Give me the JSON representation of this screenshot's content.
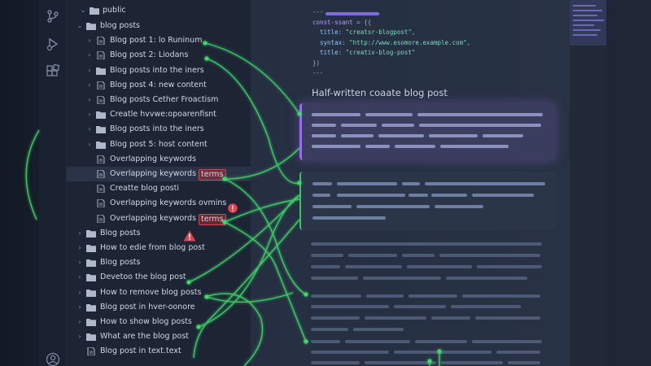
{
  "explorer": {
    "root": {
      "label": "public"
    },
    "items": [
      {
        "label": "blog posts",
        "depth": 1,
        "type": "folder",
        "chevron": "open"
      },
      {
        "label": "Blog post 1: lo Runinum",
        "depth": 2,
        "type": "file",
        "chevron": "closed"
      },
      {
        "label": "Blog post 2: Liodans",
        "depth": 2,
        "type": "file",
        "chevron": "closed"
      },
      {
        "label": "Blog posts into the iners",
        "depth": 2,
        "type": "folder",
        "chevron": "closed"
      },
      {
        "label": "Blog post 4: new content",
        "depth": 2,
        "type": "file",
        "chevron": "closed"
      },
      {
        "label": "Blog posts Cether Froactism",
        "depth": 2,
        "type": "file",
        "chevron": "closed"
      },
      {
        "label": "Creatle hvvwe:opoarenfisnt",
        "depth": 2,
        "type": "folder",
        "chevron": "closed"
      },
      {
        "label": "Blog posts into the iners",
        "depth": 2,
        "type": "folder",
        "chevron": "closed"
      },
      {
        "label": "Blog post 5: host content",
        "depth": 2,
        "type": "folder",
        "chevron": "closed"
      },
      {
        "label": "Overlapping keywords",
        "depth": 2,
        "type": "file",
        "chevron": "none"
      },
      {
        "label": "Overlapping keywords",
        "tag": "terms",
        "depth": 2,
        "type": "file",
        "chevron": "none",
        "selected": true
      },
      {
        "label": "Creatte blog posti",
        "depth": 2,
        "type": "file",
        "chevron": "none"
      },
      {
        "label": "Overlapping keywords ovmins",
        "depth": 2,
        "type": "file",
        "chevron": "none"
      },
      {
        "label": "Overlapping keywords",
        "tag": "terms",
        "depth": 2,
        "type": "file",
        "chevron": "none"
      },
      {
        "label": "Blog posts",
        "depth": 1,
        "type": "folder",
        "chevron": "closed"
      },
      {
        "label": "How to edie from blog post",
        "depth": 1,
        "type": "folder",
        "chevron": "closed"
      },
      {
        "label": "Blog posts",
        "depth": 1,
        "type": "folder",
        "chevron": "closed"
      },
      {
        "label": "Devetoo the blog post",
        "depth": 1,
        "type": "folder",
        "chevron": "closed"
      },
      {
        "label": "How to remove blog posts",
        "depth": 1,
        "type": "folder",
        "chevron": "closed"
      },
      {
        "label": "Blog post in hver-oonore",
        "depth": 1,
        "type": "folder",
        "chevron": "closed"
      },
      {
        "label": "How to show blog posts",
        "depth": 1,
        "type": "folder",
        "chevron": "closed"
      },
      {
        "label": "What are the blog post",
        "depth": 1,
        "type": "folder",
        "chevron": "closed"
      },
      {
        "label": "Blog post in text.text",
        "depth": 1,
        "type": "file",
        "chevron": "none"
      }
    ]
  },
  "editor": {
    "code": {
      "fence_open": "---",
      "line1_kw": "const-ssant",
      "line1_rest": " = {{",
      "title_key": "title",
      "title_val": "\"creatsr-blogpost\"",
      "syntax_key": "syntax",
      "syntax_val": "\"http://www.esomore.example.com\"",
      "title2_key": "title",
      "title2_val": "\"creativ-blog-post\"",
      "close": "})",
      "fence_close": "---"
    },
    "section_title": "Half-written coaate blog post"
  },
  "colors": {
    "background": "#151b27",
    "sidebar": "#1d2535",
    "editor": "#283245",
    "connector": "#3fd96b",
    "accent_purple": "#9b6cf0",
    "warning_red": "#e0434f"
  },
  "icons": {
    "activity_bar": [
      "git-branch-icon",
      "run-debug-icon",
      "extensions-icon",
      "account-icon"
    ],
    "warning": "warning-triangle-icon",
    "error": "error-circle-icon"
  }
}
